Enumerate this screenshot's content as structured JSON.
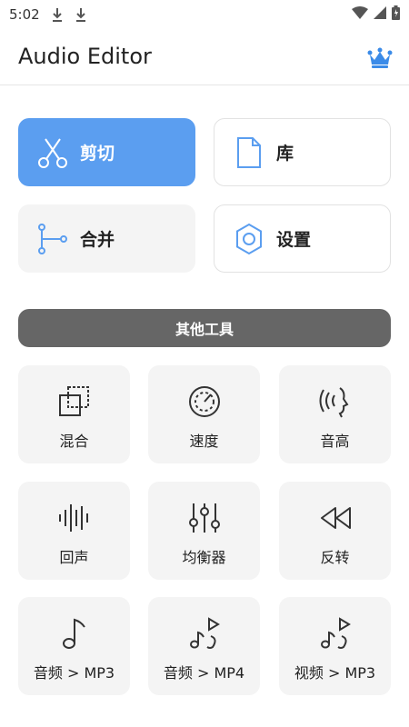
{
  "status_bar": {
    "time": "5:02"
  },
  "app_bar": {
    "title": "Audio Editor"
  },
  "primary_tiles": {
    "cut": "剪切",
    "library": "库",
    "merge": "合并",
    "settings": "设置"
  },
  "other_tools": {
    "header": "其他工具",
    "items": [
      {
        "label": "混合",
        "icon": "layers-icon"
      },
      {
        "label": "速度",
        "icon": "speedometer-icon"
      },
      {
        "label": "音高",
        "icon": "voice-icon"
      },
      {
        "label": "回声",
        "icon": "waveform-icon"
      },
      {
        "label": "均衡器",
        "icon": "equalizer-icon"
      },
      {
        "label": "反转",
        "icon": "rewind-icon"
      },
      {
        "label": "音频 > MP3",
        "icon": "music-note-icon"
      },
      {
        "label": "音频 > MP4",
        "icon": "music-video-icon"
      },
      {
        "label": "视频 > MP3",
        "icon": "video-music-icon"
      }
    ]
  },
  "colors": {
    "accent": "#5b9ef0",
    "tool_bar": "#666666",
    "crown": "#3b8be8"
  }
}
